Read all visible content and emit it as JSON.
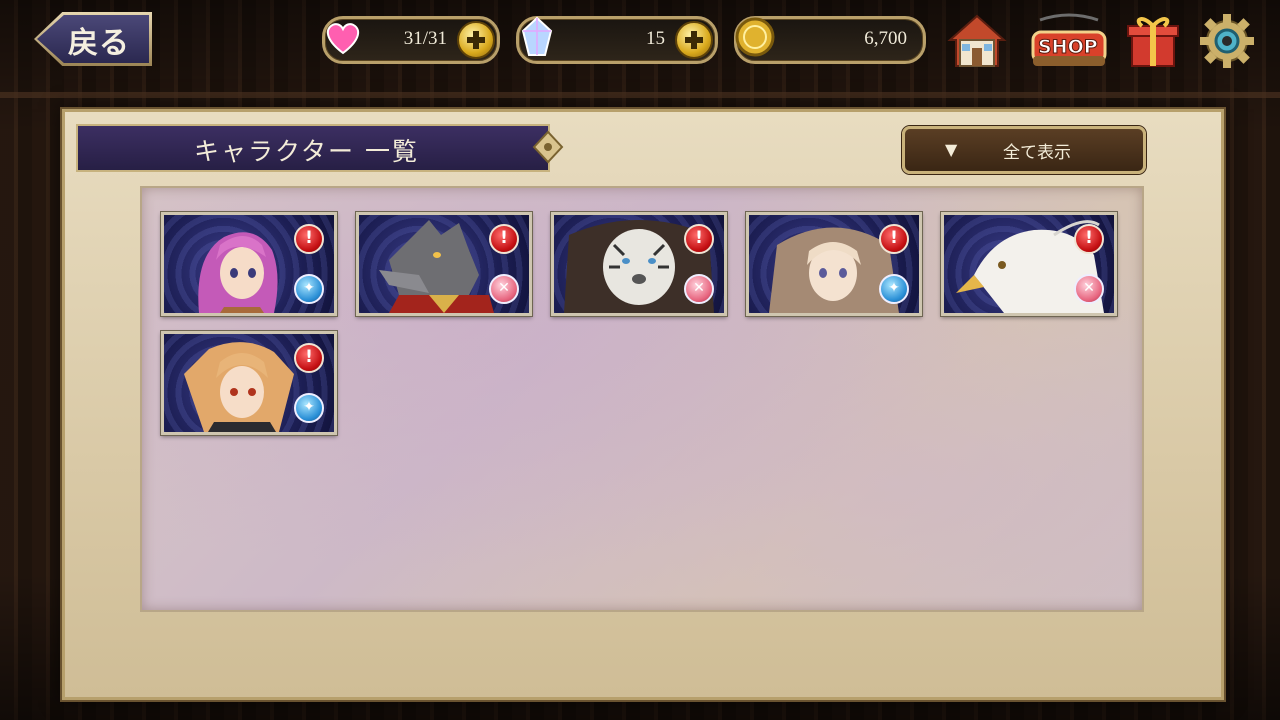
{
  "header": {
    "back_label": "戻る",
    "stamina": "31/31",
    "gems": "15",
    "coins": "6,700",
    "shop_label": "SHOP",
    "icons": [
      "home-icon",
      "shop-icon",
      "gift-icon",
      "settings-gear-icon"
    ]
  },
  "panel": {
    "title": "キャラクター 一覧",
    "filter_arrow": "▼",
    "filter_label": "全て表示"
  },
  "characters": [
    {
      "name": "pink-haired-girl",
      "alert": "!",
      "element": "water"
    },
    {
      "name": "wolf-man",
      "alert": "!",
      "element": "fire"
    },
    {
      "name": "white-tiger",
      "alert": "!",
      "element": "fire"
    },
    {
      "name": "hooded-girl",
      "alert": "!",
      "element": "water"
    },
    {
      "name": "eagle",
      "alert": "!",
      "element": "fire"
    },
    {
      "name": "blonde-girl",
      "alert": "!",
      "element": "water"
    }
  ],
  "colors": {
    "panel_bg": "#e0d2b2",
    "title_bar": "#2f2552",
    "gold_border": "#c7b27e",
    "alert_red": "#c40f12",
    "water_blue": "#2a8fd6",
    "fire_pink": "#e7657f"
  }
}
